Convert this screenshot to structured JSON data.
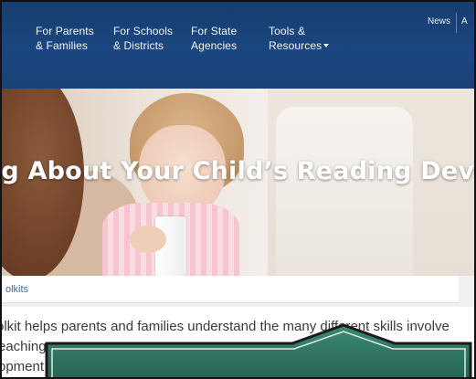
{
  "nav": {
    "items": [
      {
        "line1": "For Parents",
        "line2": "& Families"
      },
      {
        "line1": "For Schools",
        "line2": "& Districts"
      },
      {
        "line1": "For State",
        "line2": "Agencies"
      },
      {
        "line1": "Tools &",
        "line2": "Resources"
      }
    ],
    "news_label": "News",
    "cut_label": "A"
  },
  "hero": {
    "title": "ng About Your Child’s Reading Develo"
  },
  "breadcrumb": {
    "link": "olkits"
  },
  "content": {
    "line1": "olkit helps parents and families understand the many different skills involve",
    "line2": "eaching",
    "line3": "opment"
  },
  "colors": {
    "nav_bg": "#1b4680",
    "link": "#2d6fae",
    "callout_fill": "#2f7360",
    "callout_border": "#1a1a1a"
  }
}
